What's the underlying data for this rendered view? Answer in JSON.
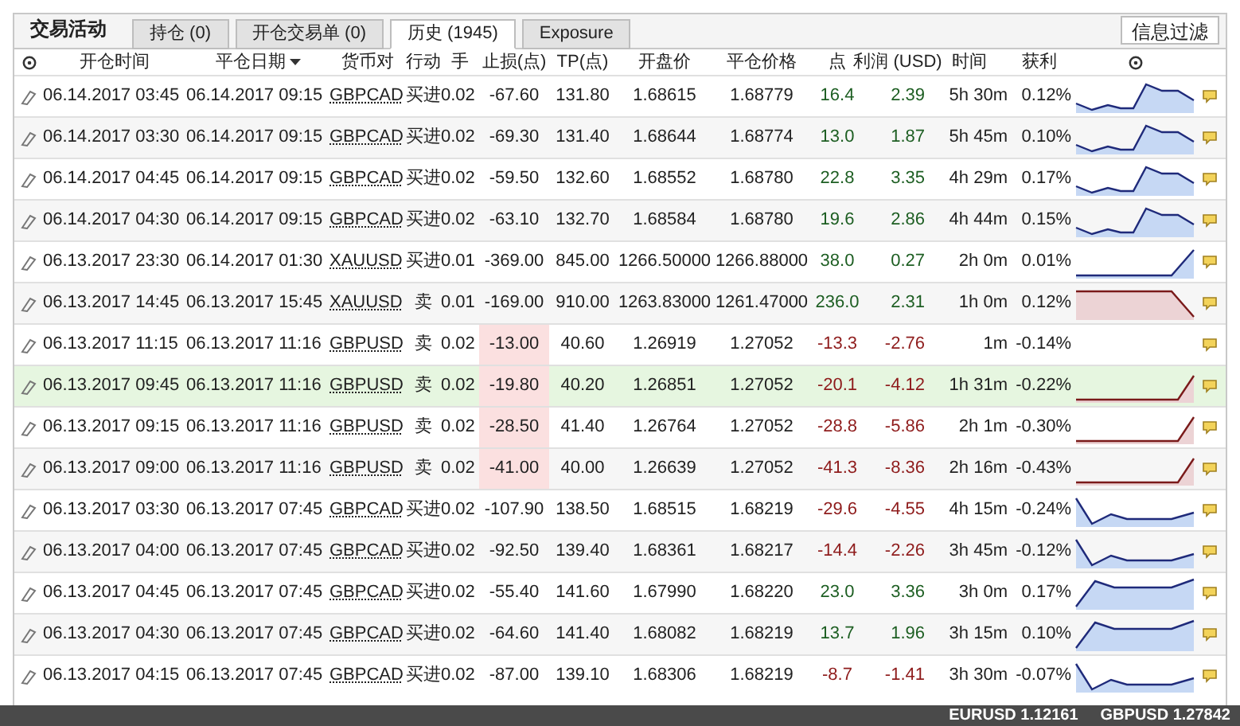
{
  "panel_title": "交易活动",
  "tabs": [
    {
      "label": "持仓 (0)",
      "selected": false
    },
    {
      "label": "开仓交易单 (0)",
      "selected": false
    },
    {
      "label": "历史 (1945)",
      "selected": true
    },
    {
      "label": "Exposure",
      "selected": false
    }
  ],
  "filter_button": "信息过滤",
  "columns": [
    "开仓时间",
    "平仓日期",
    "货币对",
    "行动",
    "手",
    "止损(点)",
    "TP(点)",
    "开盘价",
    "平仓价格",
    "点",
    "利润 (USD)",
    "时间",
    "获利"
  ],
  "rows": [
    {
      "open_time": "06.14.2017 03:45",
      "close_time": "06.14.2017 09:15",
      "pair": "GBPCAD",
      "action": "买进",
      "lots": "0.02",
      "sl": "-67.60",
      "tp": "131.80",
      "open_price": "1.68615",
      "close_price": "1.68779",
      "points": "16.4",
      "profit": "2.39",
      "duration": "5h 30m",
      "percent": "0.12%",
      "positive": true,
      "sl_flag": false,
      "selected": false,
      "kind": "peak"
    },
    {
      "open_time": "06.14.2017 03:30",
      "close_time": "06.14.2017 09:15",
      "pair": "GBPCAD",
      "action": "买进",
      "lots": "0.02",
      "sl": "-69.30",
      "tp": "131.40",
      "open_price": "1.68644",
      "close_price": "1.68774",
      "points": "13.0",
      "profit": "1.87",
      "duration": "5h 45m",
      "percent": "0.10%",
      "positive": true,
      "sl_flag": false,
      "selected": false,
      "kind": "peak"
    },
    {
      "open_time": "06.14.2017 04:45",
      "close_time": "06.14.2017 09:15",
      "pair": "GBPCAD",
      "action": "买进",
      "lots": "0.02",
      "sl": "-59.50",
      "tp": "132.60",
      "open_price": "1.68552",
      "close_price": "1.68780",
      "points": "22.8",
      "profit": "3.35",
      "duration": "4h 29m",
      "percent": "0.17%",
      "positive": true,
      "sl_flag": false,
      "selected": false,
      "kind": "peak"
    },
    {
      "open_time": "06.14.2017 04:30",
      "close_time": "06.14.2017 09:15",
      "pair": "GBPCAD",
      "action": "买进",
      "lots": "0.02",
      "sl": "-63.10",
      "tp": "132.70",
      "open_price": "1.68584",
      "close_price": "1.68780",
      "points": "19.6",
      "profit": "2.86",
      "duration": "4h 44m",
      "percent": "0.15%",
      "positive": true,
      "sl_flag": false,
      "selected": false,
      "kind": "peak"
    },
    {
      "open_time": "06.13.2017 23:30",
      "close_time": "06.14.2017 01:30",
      "pair": "XAUUSD",
      "action": "买进",
      "lots": "0.01",
      "sl": "-369.00",
      "tp": "845.00",
      "open_price": "1266.50000",
      "close_price": "1266.88000",
      "points": "38.0",
      "profit": "0.27",
      "duration": "2h 0m",
      "percent": "0.01%",
      "positive": true,
      "sl_flag": false,
      "selected": false,
      "kind": "rise"
    },
    {
      "open_time": "06.13.2017 14:45",
      "close_time": "06.13.2017 15:45",
      "pair": "XAUUSD",
      "action": "卖",
      "lots": "0.01",
      "sl": "-169.00",
      "tp": "910.00",
      "open_price": "1263.83000",
      "close_price": "1261.47000",
      "points": "236.0",
      "profit": "2.31",
      "duration": "1h 0m",
      "percent": "0.12%",
      "positive": true,
      "sl_flag": false,
      "selected": false,
      "kind": "fall"
    },
    {
      "open_time": "06.13.2017 11:15",
      "close_time": "06.13.2017 11:16",
      "pair": "GBPUSD",
      "action": "卖",
      "lots": "0.02",
      "sl": "-13.00",
      "tp": "40.60",
      "open_price": "1.26919",
      "close_price": "1.27052",
      "points": "-13.3",
      "profit": "-2.76",
      "duration": "1m",
      "percent": "-0.14%",
      "positive": false,
      "sl_flag": true,
      "selected": false,
      "kind": "none"
    },
    {
      "open_time": "06.13.2017 09:45",
      "close_time": "06.13.2017 11:16",
      "pair": "GBPUSD",
      "action": "卖",
      "lots": "0.02",
      "sl": "-19.80",
      "tp": "40.20",
      "open_price": "1.26851",
      "close_price": "1.27052",
      "points": "-20.1",
      "profit": "-4.12",
      "duration": "1h 31m",
      "percent": "-0.22%",
      "positive": false,
      "sl_flag": true,
      "selected": true,
      "kind": "late_rise"
    },
    {
      "open_time": "06.13.2017 09:15",
      "close_time": "06.13.2017 11:16",
      "pair": "GBPUSD",
      "action": "卖",
      "lots": "0.02",
      "sl": "-28.50",
      "tp": "41.40",
      "open_price": "1.26764",
      "close_price": "1.27052",
      "points": "-28.8",
      "profit": "-5.86",
      "duration": "2h 1m",
      "percent": "-0.30%",
      "positive": false,
      "sl_flag": true,
      "selected": false,
      "kind": "late_rise"
    },
    {
      "open_time": "06.13.2017 09:00",
      "close_time": "06.13.2017 11:16",
      "pair": "GBPUSD",
      "action": "卖",
      "lots": "0.02",
      "sl": "-41.00",
      "tp": "40.00",
      "open_price": "1.26639",
      "close_price": "1.27052",
      "points": "-41.3",
      "profit": "-8.36",
      "duration": "2h 16m",
      "percent": "-0.43%",
      "positive": false,
      "sl_flag": true,
      "selected": false,
      "kind": "late_rise"
    },
    {
      "open_time": "06.13.2017 03:30",
      "close_time": "06.13.2017 07:45",
      "pair": "GBPCAD",
      "action": "买进",
      "lots": "0.02",
      "sl": "-107.90",
      "tp": "138.50",
      "open_price": "1.68515",
      "close_price": "1.68219",
      "points": "-29.6",
      "profit": "-4.55",
      "duration": "4h 15m",
      "percent": "-0.24%",
      "positive": false,
      "sl_flag": false,
      "selected": false,
      "kind": "dip"
    },
    {
      "open_time": "06.13.2017 04:00",
      "close_time": "06.13.2017 07:45",
      "pair": "GBPCAD",
      "action": "买进",
      "lots": "0.02",
      "sl": "-92.50",
      "tp": "139.40",
      "open_price": "1.68361",
      "close_price": "1.68217",
      "points": "-14.4",
      "profit": "-2.26",
      "duration": "3h 45m",
      "percent": "-0.12%",
      "positive": false,
      "sl_flag": false,
      "selected": false,
      "kind": "dip"
    },
    {
      "open_time": "06.13.2017 04:45",
      "close_time": "06.13.2017 07:45",
      "pair": "GBPCAD",
      "action": "买进",
      "lots": "0.02",
      "sl": "-55.40",
      "tp": "141.60",
      "open_price": "1.67990",
      "close_price": "1.68220",
      "points": "23.0",
      "profit": "3.36",
      "duration": "3h 0m",
      "percent": "0.17%",
      "positive": true,
      "sl_flag": false,
      "selected": false,
      "kind": "climb"
    },
    {
      "open_time": "06.13.2017 04:30",
      "close_time": "06.13.2017 07:45",
      "pair": "GBPCAD",
      "action": "买进",
      "lots": "0.02",
      "sl": "-64.60",
      "tp": "141.40",
      "open_price": "1.68082",
      "close_price": "1.68219",
      "points": "13.7",
      "profit": "1.96",
      "duration": "3h 15m",
      "percent": "0.10%",
      "positive": true,
      "sl_flag": false,
      "selected": false,
      "kind": "climb"
    },
    {
      "open_time": "06.13.2017 04:15",
      "close_time": "06.13.2017 07:45",
      "pair": "GBPCAD",
      "action": "买进",
      "lots": "0.02",
      "sl": "-87.00",
      "tp": "139.10",
      "open_price": "1.68306",
      "close_price": "1.68219",
      "points": "-8.7",
      "profit": "-1.41",
      "duration": "3h 30m",
      "percent": "-0.07%",
      "positive": false,
      "sl_flag": false,
      "selected": false,
      "kind": "dip"
    }
  ],
  "status_bar": [
    "EURUSD 1.12161",
    "GBPUSD 1.27842"
  ]
}
